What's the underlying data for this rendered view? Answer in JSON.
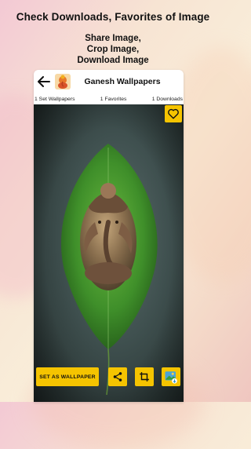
{
  "promo": {
    "title": "Check  Downloads, Favorites of Image",
    "line1": "Share Image,",
    "line2": "Crop Image,",
    "line3": "Download Image"
  },
  "app": {
    "title": "Ganesh Wallpapers"
  },
  "stats": {
    "set_wallpapers": "1 Set Wallpapers",
    "favorites": "1 Favorites",
    "downloads": "1 Downloads"
  },
  "actions": {
    "set_wallpaper_label": "SET AS WALLPAPER"
  },
  "icons": {
    "back": "arrow-left-icon",
    "favorite": "heart-outline-icon",
    "share": "share-icon",
    "crop": "crop-icon",
    "download": "image-download-icon"
  },
  "colors": {
    "accent": "#f5c400",
    "leaf": "#3f8f2a",
    "background_dark": "#3f504f"
  }
}
